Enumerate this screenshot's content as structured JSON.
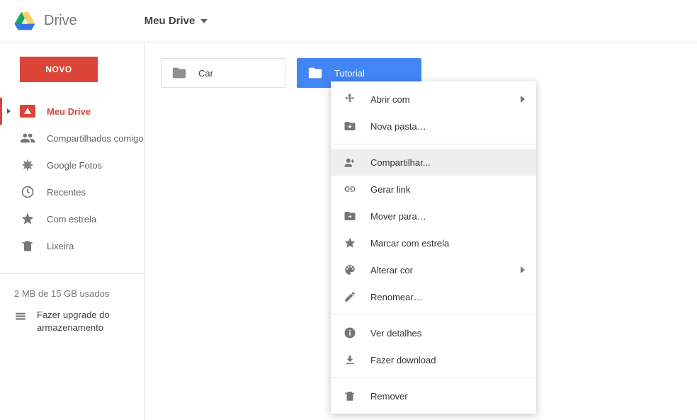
{
  "header": {
    "app_name": "Drive",
    "breadcrumb": "Meu Drive"
  },
  "sidebar": {
    "new_button": "NOVO",
    "items": [
      {
        "label": "Meu Drive"
      },
      {
        "label": "Compartilhados comigo"
      },
      {
        "label": "Google Fotos"
      },
      {
        "label": "Recentes"
      },
      {
        "label": "Com estrela"
      },
      {
        "label": "Lixeira"
      }
    ],
    "storage_text": "2 MB de 15 GB usados",
    "upgrade_text": "Fazer upgrade do armazenamento"
  },
  "content": {
    "folders": [
      {
        "label": "Car"
      },
      {
        "label": "Tutorial"
      }
    ]
  },
  "context_menu": {
    "open_with": "Abrir com",
    "new_folder": "Nova pasta…",
    "share": "Compartilhar...",
    "get_link": "Gerar link",
    "move_to": "Mover para…",
    "star": "Marcar com estrela",
    "change_color": "Alterar cor",
    "rename": "Renomear…",
    "details": "Ver detalhes",
    "download": "Fazer download",
    "remove": "Remover"
  }
}
